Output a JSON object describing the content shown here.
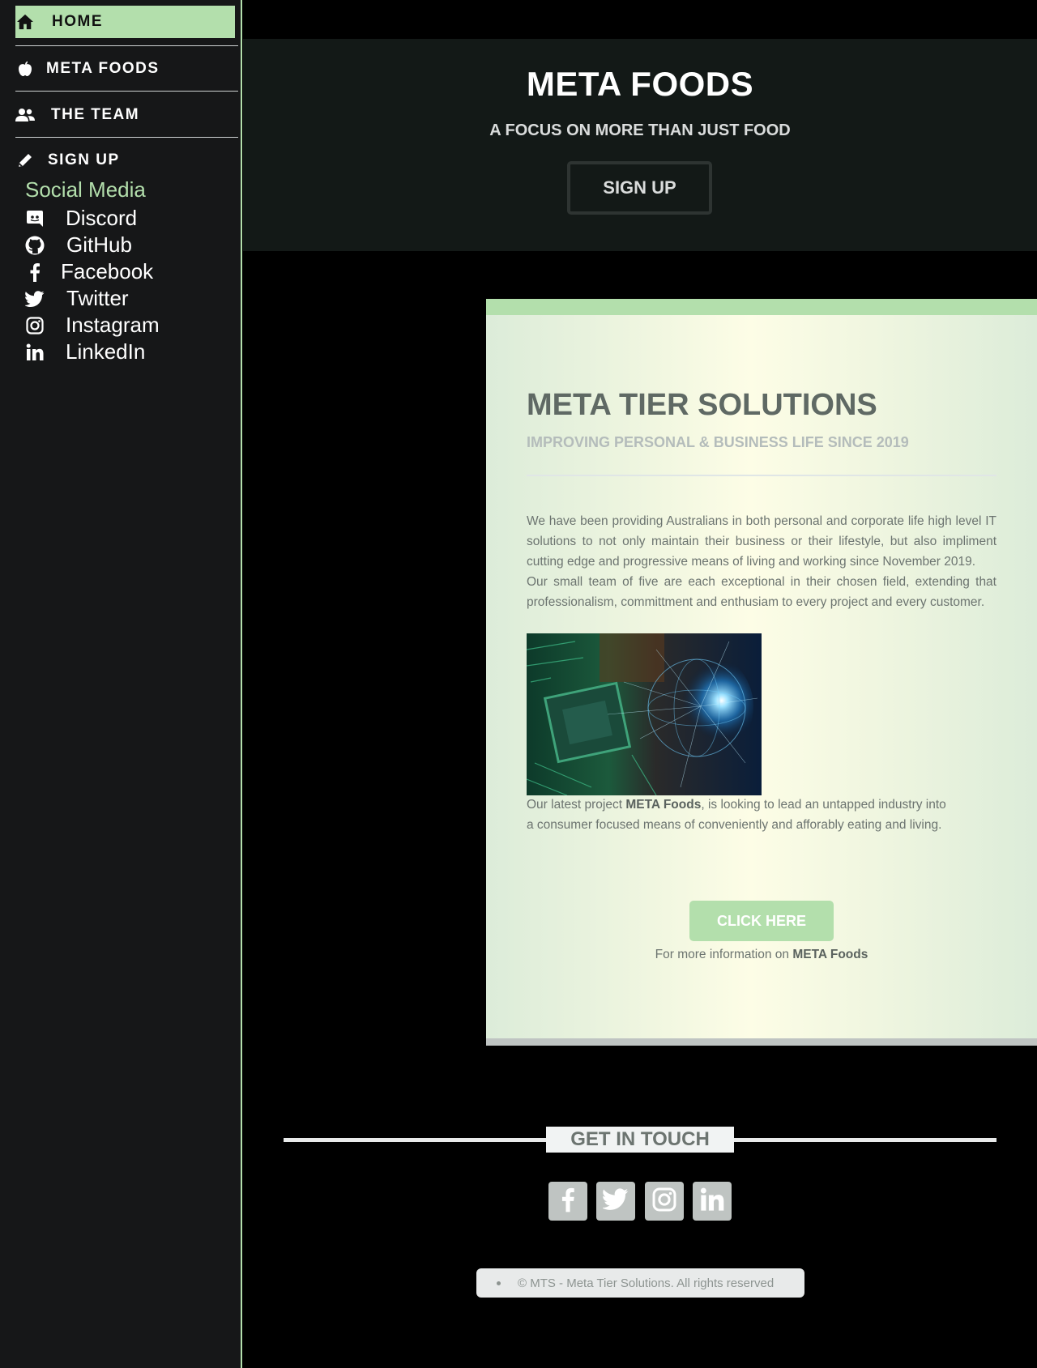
{
  "sidebar": {
    "nav": [
      {
        "label": "HOME",
        "icon": "home-icon",
        "active": true
      },
      {
        "label": "META FOODS",
        "icon": "apple-icon"
      },
      {
        "label": "THE TEAM",
        "icon": "users-icon"
      },
      {
        "label": "SIGN UP",
        "icon": "pencil-icon"
      }
    ],
    "social_title": "Social Media",
    "social": [
      {
        "label": "Discord",
        "icon": "discord-icon"
      },
      {
        "label": "GitHub",
        "icon": "github-icon"
      },
      {
        "label": "Facebook",
        "icon": "facebook-icon"
      },
      {
        "label": "Twitter",
        "icon": "twitter-icon"
      },
      {
        "label": "Instagram",
        "icon": "instagram-icon"
      },
      {
        "label": "LinkedIn",
        "icon": "linkedin-icon"
      }
    ]
  },
  "hero": {
    "title": "META FOODS",
    "subtitle": "A FOCUS ON MORE THAN JUST FOOD",
    "button": "SIGN UP"
  },
  "card": {
    "title": "META TIER SOLUTIONS",
    "subtitle": "IMPROVING PERSONAL & BUSINESS LIFE SINCE 2019",
    "para1": "We have been providing Australians in both personal and corporate life high level IT solutions to not only maintain their business or their lifestyle, but also impliment cutting edge and progressive means of living and working since November 2019.",
    "para2": "Our small team of five are each exceptional in their chosen field, extending that professionalism, committment and enthusiam to every project and every customer.",
    "project_prefix": "Our latest project ",
    "project_name": "META Foods",
    "project_suffix": ", is looking to lead an untapped industry into a consumer focused means of conveniently and afforably eating and living.",
    "cta": "CLICK HERE",
    "more_prefix": "For more information on ",
    "more_name": "META Foods"
  },
  "footer": {
    "get_in_touch": "GET IN TOUCH",
    "socials": [
      "facebook-icon",
      "twitter-icon",
      "instagram-icon",
      "linkedin-icon"
    ],
    "copyright": "© MTS - Meta Tier Solutions. All rights reserved"
  },
  "colors": {
    "accent": "#b3dfac",
    "sidebar_bg": "#161718",
    "hero_bg": "#131917",
    "heading_text": "#5f6964",
    "body_text": "#6c7470",
    "social_btn": "#bfc4c2"
  }
}
